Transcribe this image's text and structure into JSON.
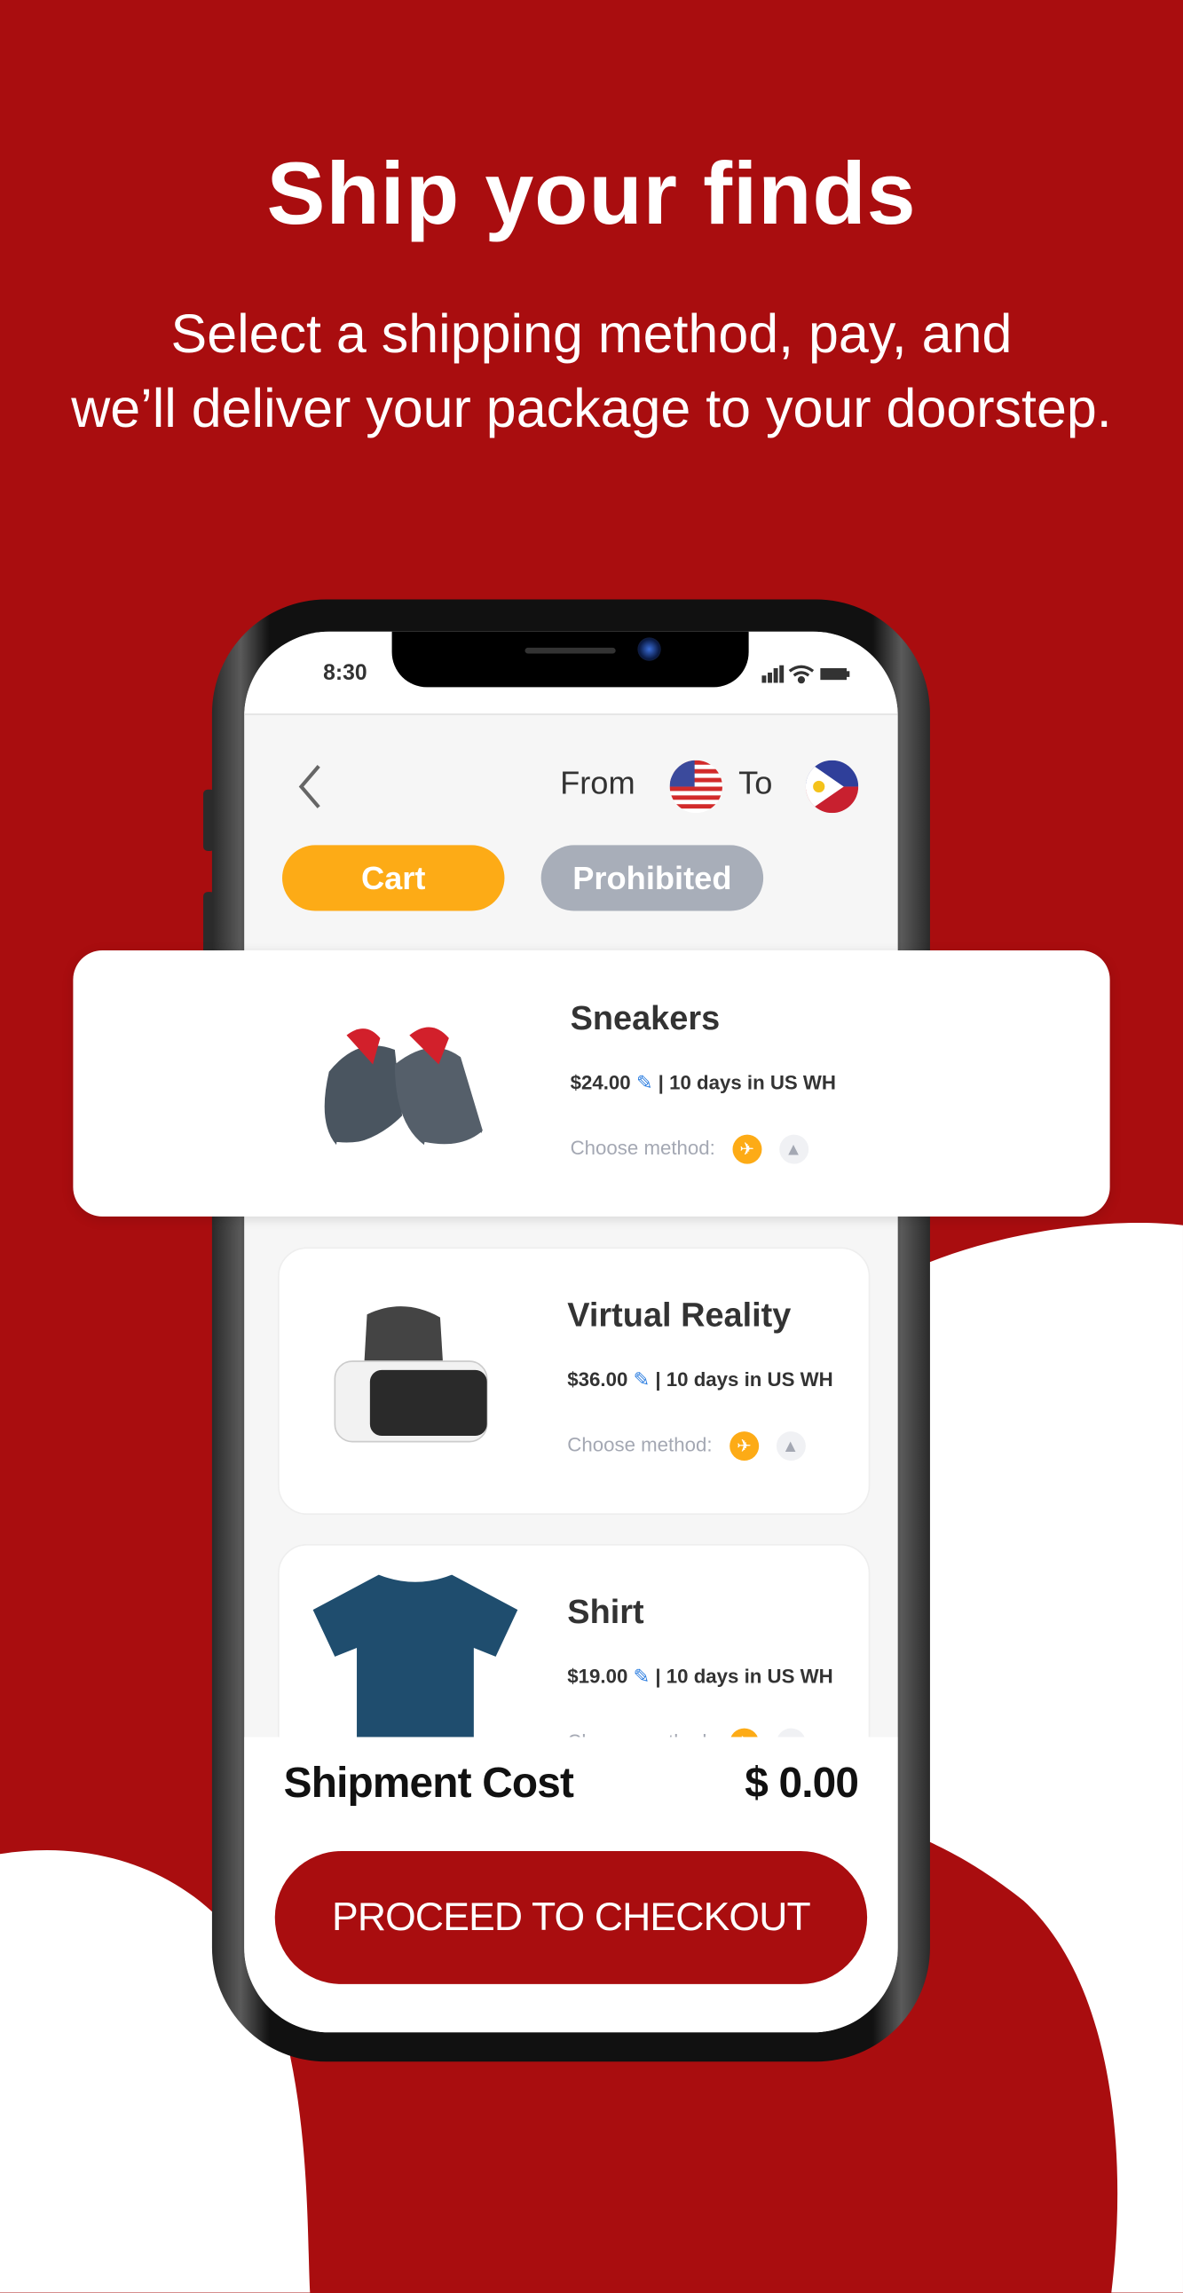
{
  "header": {
    "title": "Ship your finds",
    "subtitle_line1": "Select a shipping method, pay, and",
    "subtitle_line2": "we’ll deliver your package to your doorstep."
  },
  "colors": {
    "brand_red": "#a90d0f",
    "cart_tab": "#fdab16",
    "prohibited_tab": "#a8aeb9",
    "edit_icon": "#2b7de0"
  },
  "status_bar": {
    "time": "8:30",
    "icons": [
      "signal-icon",
      "wifi-icon",
      "battery-icon"
    ]
  },
  "nav": {
    "back_icon": "chevron-left-icon",
    "from_label": "From",
    "from_flag": "us-flag-icon",
    "to_label": "To",
    "to_flag": "ph-flag-icon"
  },
  "tabs": [
    {
      "label": "Cart",
      "active": true
    },
    {
      "label": "Prohibited",
      "active": false
    }
  ],
  "items": [
    {
      "name": "Sneakers",
      "price": "$24.00",
      "storage": "10 days in US WH",
      "method_label": "Choose method:",
      "methods": [
        "airplane-icon",
        "ship-icon"
      ],
      "image": "sneakers"
    },
    {
      "name": "Virtual Reality",
      "price": "$36.00",
      "storage": "10 days in US WH",
      "method_label": "Choose method:",
      "methods": [
        "airplane-icon",
        "ship-icon"
      ],
      "image": "vr-headset"
    },
    {
      "name": "Shirt",
      "price": "$19.00",
      "storage": "10 days in US WH",
      "method_label": "Choose method:",
      "methods": [
        "airplane-icon",
        "ship-icon"
      ],
      "image": "t-shirt"
    }
  ],
  "footer": {
    "cost_label": "Shipment Cost",
    "cost_value": "$ 0.00",
    "checkout_label": "PROCEED TO CHECKOUT"
  }
}
